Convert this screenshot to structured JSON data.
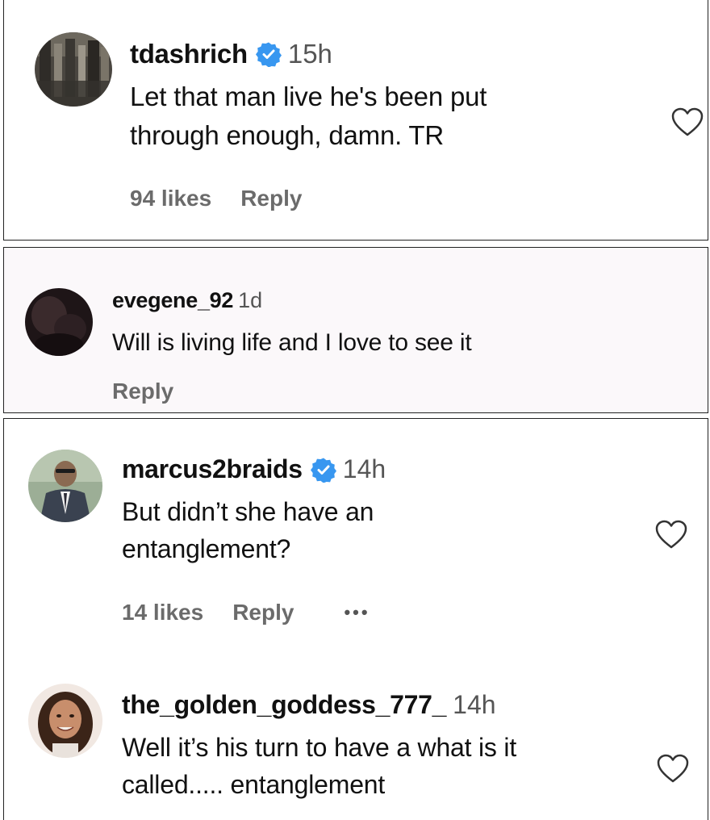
{
  "comments": [
    {
      "username": "tdashrich",
      "verified": true,
      "time": "15h",
      "text_line1": "Let that man live he's been put",
      "text_line2": "through enough, damn. TR",
      "likes": "94 likes",
      "reply": "Reply"
    },
    {
      "username": "evegene_92",
      "verified": false,
      "time": "1d",
      "text_line1": "Will is living life and I love to see it",
      "reply": "Reply"
    },
    {
      "username": "marcus2braids",
      "verified": true,
      "time": "14h",
      "text_line1": "But didn’t she have an",
      "text_line2": "entanglement?",
      "likes": "14 likes",
      "reply": "Reply",
      "more": "•••"
    },
    {
      "username": "the_golden_goddess_777_",
      "verified": false,
      "time": "14h",
      "text_line1": "Well it’s his turn to have a what is it",
      "text_line2": "called..... entanglement"
    }
  ],
  "colors": {
    "verified_badge": "#3897f0",
    "meta_text": "#6b6b6b",
    "panel_border": "#222222"
  },
  "icons": {
    "like": "heart-outline-icon",
    "verified": "verified-badge-icon"
  }
}
